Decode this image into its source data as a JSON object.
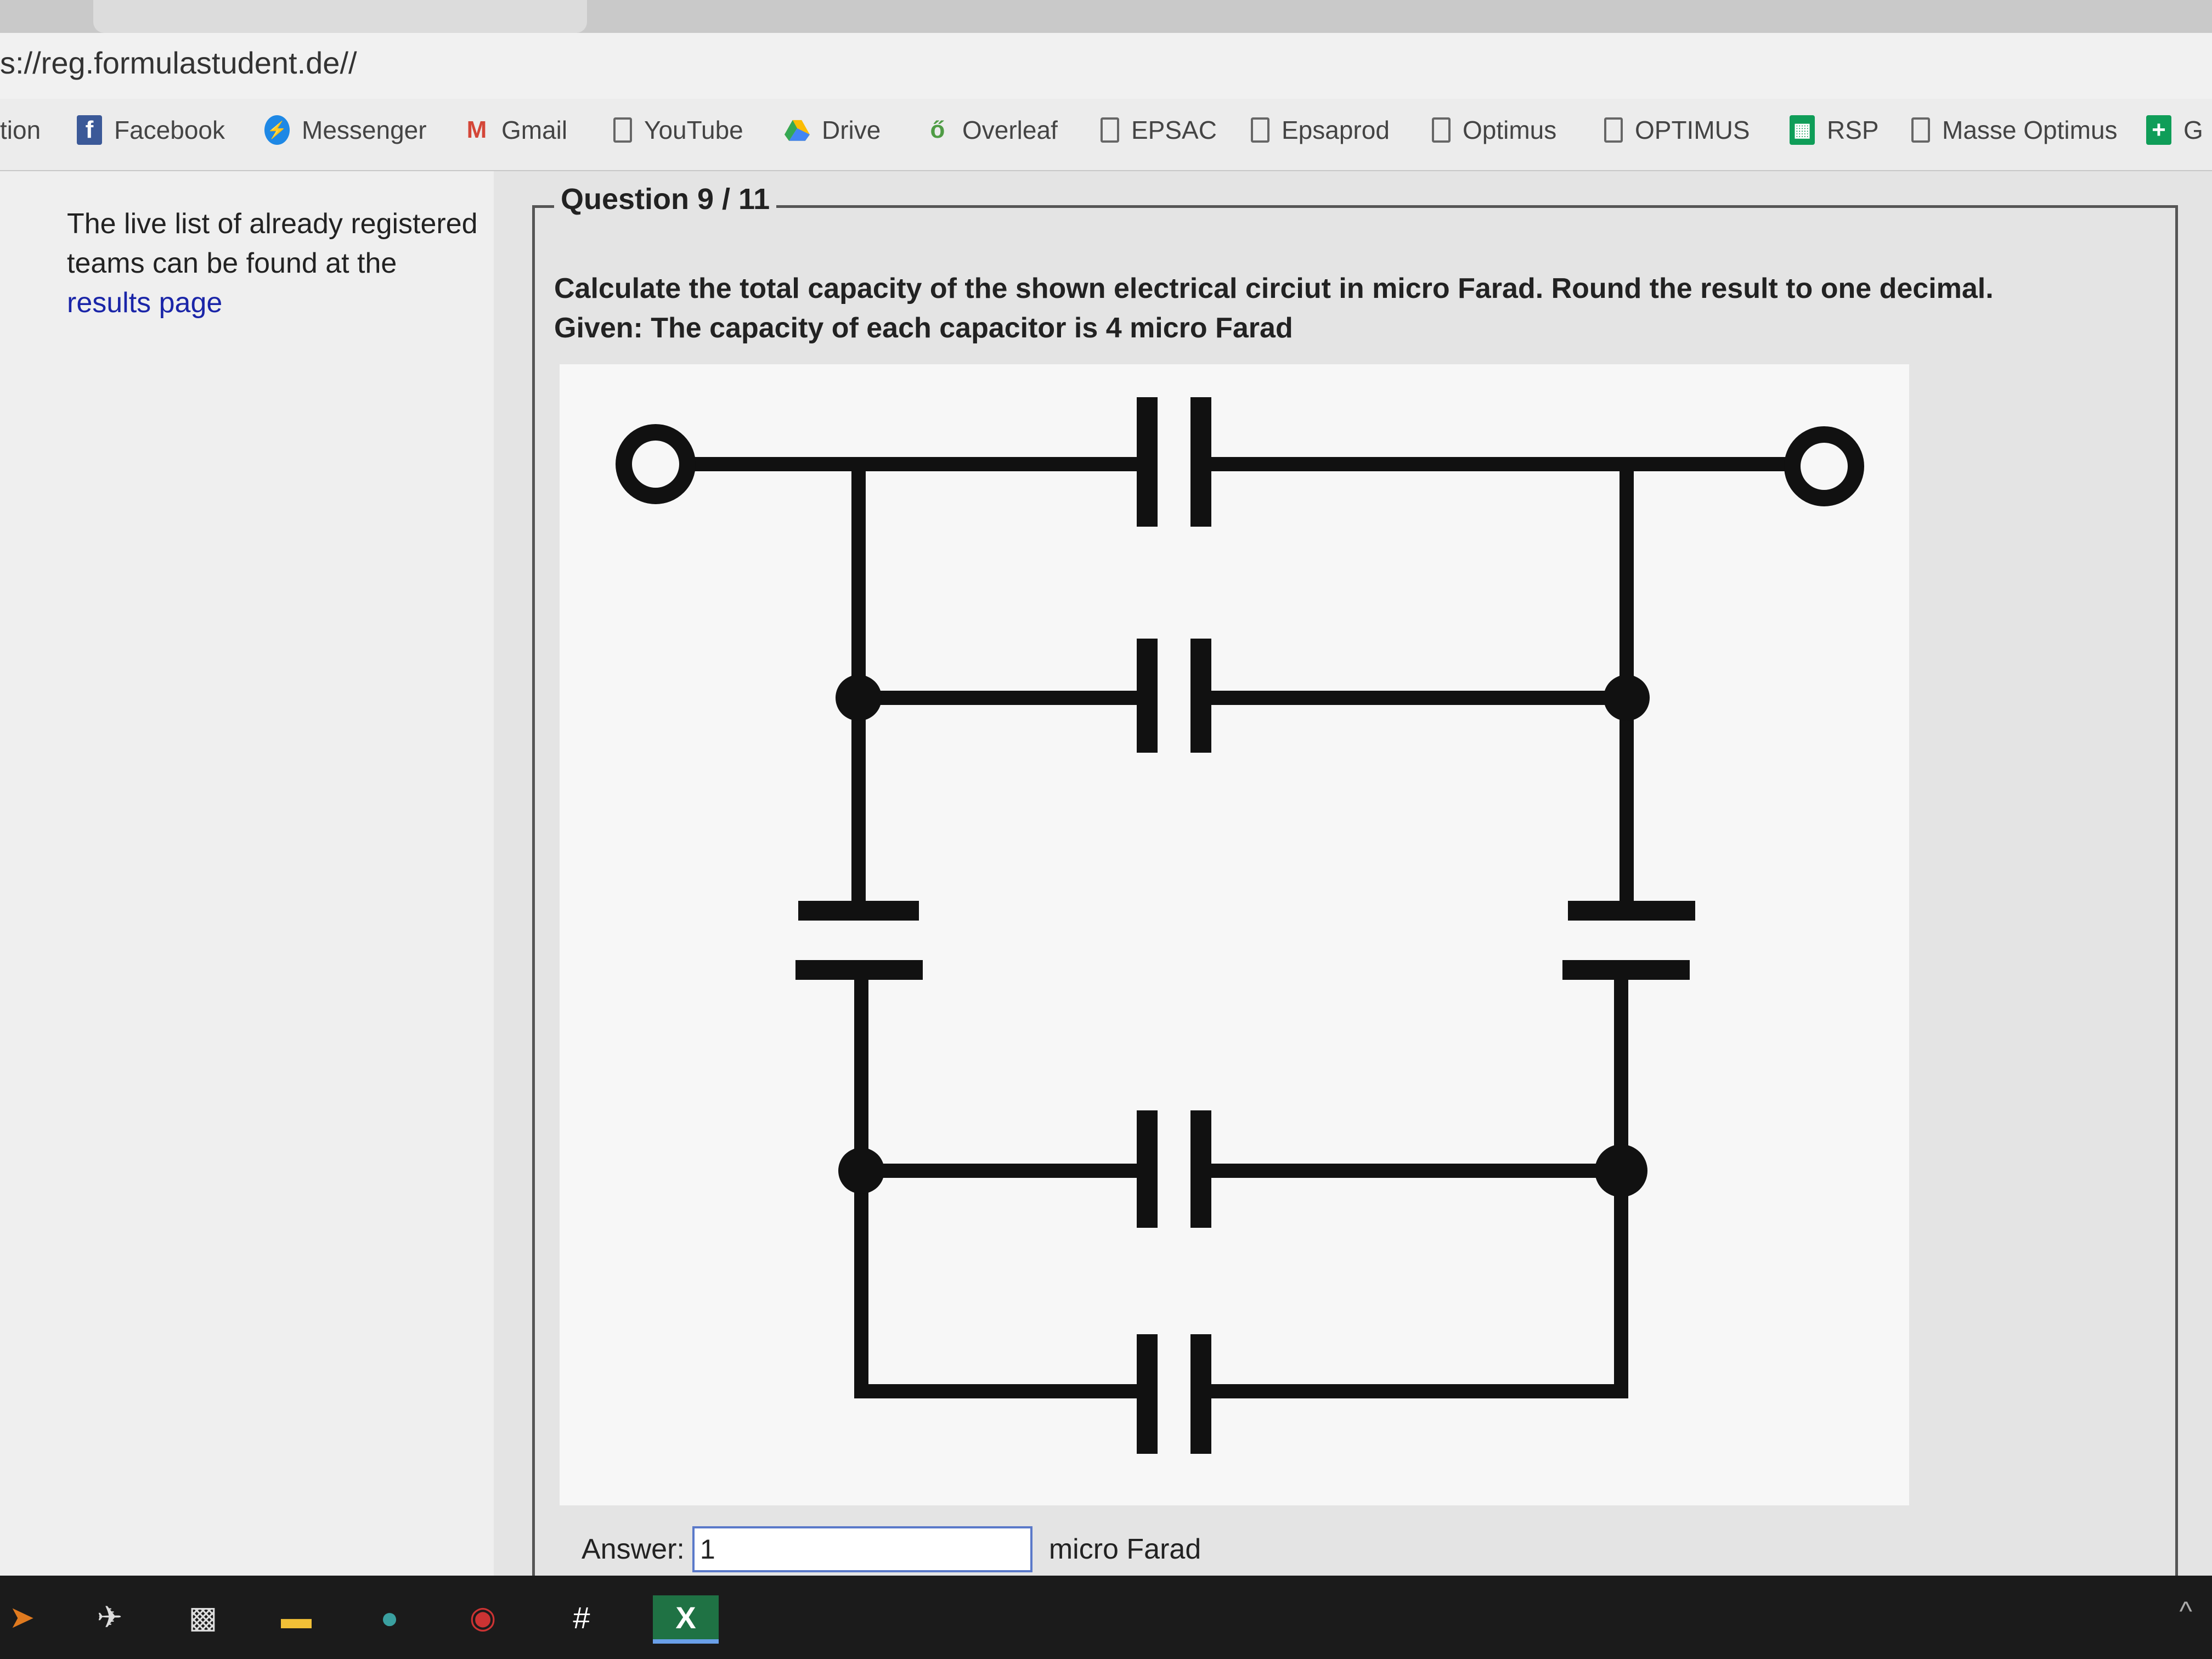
{
  "browser": {
    "url": "s://reg.formulastudent.de//",
    "bookmarks": [
      {
        "label": "tion",
        "icon": "none"
      },
      {
        "label": "Facebook",
        "icon": "facebook-icon"
      },
      {
        "label": "Messenger",
        "icon": "messenger-icon"
      },
      {
        "label": "Gmail",
        "icon": "gmail-icon"
      },
      {
        "label": "YouTube",
        "icon": "document-icon"
      },
      {
        "label": "Drive",
        "icon": "drive-icon"
      },
      {
        "label": "Overleaf",
        "icon": "overleaf-icon"
      },
      {
        "label": "EPSAC",
        "icon": "document-icon"
      },
      {
        "label": "Epsaprod",
        "icon": "document-icon"
      },
      {
        "label": "Optimus",
        "icon": "document-icon"
      },
      {
        "label": "OPTIMUS",
        "icon": "document-icon"
      },
      {
        "label": "RSP",
        "icon": "sheets-icon"
      },
      {
        "label": "Masse Optimus",
        "icon": "document-icon"
      },
      {
        "label": "G",
        "icon": "plus-icon"
      }
    ]
  },
  "sidebar": {
    "text": "The live list of already registered teams can be found at the",
    "link": "results page"
  },
  "question": {
    "legend": "Question 9 / 11",
    "line1": "Calculate the total capacity of the shown electrical circiut in micro Farad. Round the result to one decimal.",
    "line2": "Given: The capacity of each capacitor is 4 micro Farad"
  },
  "answer": {
    "label": "Answer:",
    "value": "1",
    "unit": "micro Farad"
  },
  "taskbar": {
    "items": [
      "app-icon",
      "app-icon",
      "photo-app-icon",
      "file-explorer-icon",
      "app-icon",
      "camera-icon",
      "slack-icon",
      "excel-icon"
    ],
    "excel_label": "X"
  },
  "colors": {
    "link": "#1a25a8",
    "taskbar": "#1b1b1b",
    "input_border": "#5a79c9"
  }
}
